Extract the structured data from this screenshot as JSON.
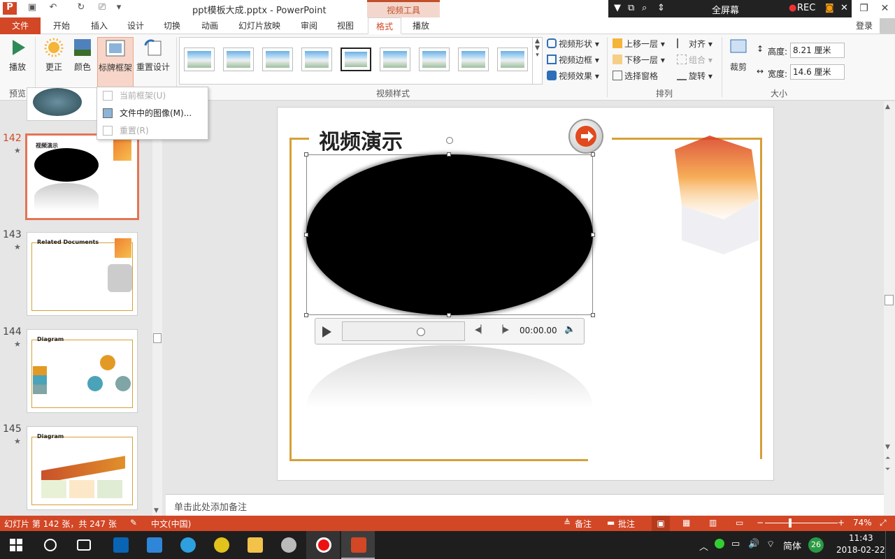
{
  "window": {
    "title": "ppt模板大成.pptx - PowerPoint",
    "context_tab_title": "视频工具",
    "fullscreen_label": "全屏幕",
    "rec_label": "REC",
    "signin": "登录"
  },
  "tabs": [
    "文件",
    "开始",
    "插入",
    "设计",
    "切换",
    "动画",
    "幻灯片放映",
    "审阅",
    "视图",
    "格式",
    "播放"
  ],
  "active_tab": "格式",
  "ribbon": {
    "preview_group": "预览",
    "play": "播放",
    "correct": "更正",
    "color": "颜色",
    "poster_frame": "标牌框架",
    "reset_design": "重置设计",
    "video_styles_group": "视频样式",
    "video_shape": "视频形状",
    "video_border": "视频边框",
    "video_effects": "视频效果",
    "arrange_group": "排列",
    "bring_forward": "上移一层",
    "send_backward": "下移一层",
    "selection_pane": "选择窗格",
    "align": "对齐",
    "group": "组合",
    "rotate": "旋转",
    "size_group": "大小",
    "crop": "裁剪",
    "height_label": "高度:",
    "height_value": "8.21 厘米",
    "width_label": "宽度:",
    "width_value": "14.6 厘米"
  },
  "dropdown": {
    "current_frame": "当前框架(U)",
    "image_from_file": "文件中的图像(M)...",
    "reset": "重置(R)"
  },
  "slides": [
    {
      "num": "142",
      "title": "视频演示"
    },
    {
      "num": "143",
      "title": "Related Documents"
    },
    {
      "num": "144",
      "title": "Diagram"
    },
    {
      "num": "145",
      "title": "Diagram"
    }
  ],
  "slide": {
    "title": "视频演示",
    "time": "00:00.00"
  },
  "notes_placeholder": "单击此处添加备注",
  "status": {
    "slide_info": "幻灯片 第 142 张，共 247 张",
    "language": "中文(中国)",
    "notes": "备注",
    "comments": "批注",
    "zoom": "74%"
  },
  "taskbar": {
    "ime": "简体",
    "badge": "26",
    "time": "11:43",
    "date": "2018-02-22"
  },
  "colors": {
    "accent": "#d24726",
    "frame": "#d6a038"
  }
}
